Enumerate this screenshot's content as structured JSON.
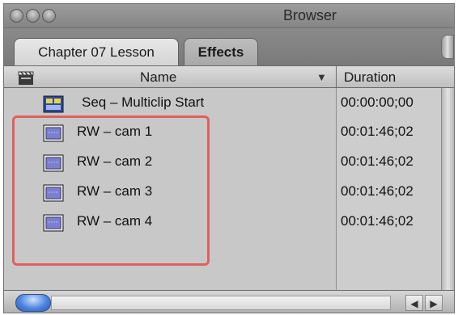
{
  "window": {
    "title": "Browser"
  },
  "tabs": [
    {
      "label": "Chapter 07 Lesson",
      "active": true
    },
    {
      "label": "Effects",
      "active": false
    }
  ],
  "columns": {
    "name": "Name",
    "duration": "Duration"
  },
  "rows": [
    {
      "icon": "sequence-icon",
      "name": "Seq – Multiclip Start",
      "duration": "00:00:00;00"
    },
    {
      "icon": "clip-icon",
      "name": "RW – cam 1",
      "duration": "00:01:46;02"
    },
    {
      "icon": "clip-icon",
      "name": "RW – cam 2",
      "duration": "00:01:46;02"
    },
    {
      "icon": "clip-icon",
      "name": "RW – cam 3",
      "duration": "00:01:46;02"
    },
    {
      "icon": "clip-icon",
      "name": "RW – cam 4",
      "duration": "00:01:46;02"
    }
  ],
  "colors": {
    "highlight": "#e0605e",
    "accent": "#4d86e0"
  }
}
